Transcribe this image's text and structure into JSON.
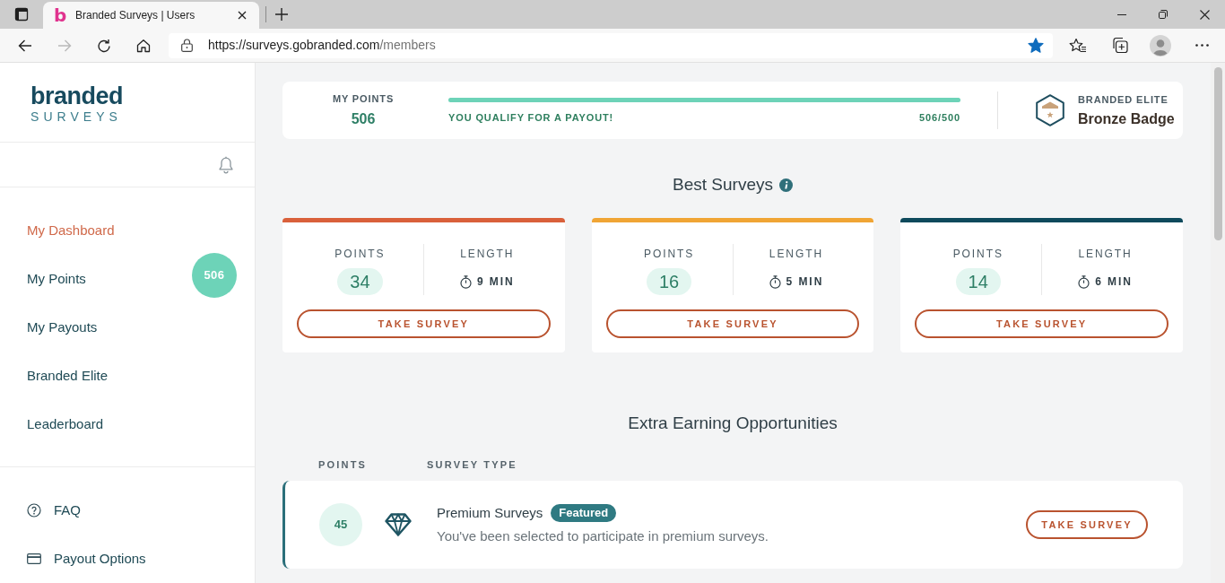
{
  "browser": {
    "favicon": "b",
    "tab_title": "Branded Surveys | Users",
    "url_origin": "https://surveys.gobranded.com",
    "url_path": "/members",
    "forward_disabled": true,
    "bookmarked": true
  },
  "sidebar": {
    "logo": {
      "word": "branded",
      "tagline": "SURVEYS"
    },
    "nav": [
      {
        "label": "My Dashboard",
        "selected": true
      },
      {
        "label": "My Points",
        "selected": false,
        "badge": "506"
      },
      {
        "label": "My Payouts",
        "selected": false
      },
      {
        "label": "Branded Elite",
        "selected": false
      },
      {
        "label": "Leaderboard",
        "selected": false
      }
    ],
    "footer_links": [
      {
        "kind": "help",
        "label": "FAQ"
      },
      {
        "kind": "card",
        "label": "Payout Options"
      }
    ]
  },
  "points_summary": {
    "label": "MY POINTS",
    "value": "506",
    "progress": {
      "level": 1,
      "message": "YOU QUALIFY FOR A PAYOUT!",
      "reading": "506/500"
    },
    "elite": {
      "label": "BRANDED ELITE",
      "badge": "Bronze Badge"
    }
  },
  "best_surveys": {
    "title": "Best Surveys",
    "cards": [
      {
        "color": "#d9603b",
        "points_label": "POINTS",
        "points": "34",
        "length_label": "LENGTH",
        "length": "9 MIN",
        "button": "TAKE SURVEY"
      },
      {
        "color": "#f0a535",
        "points_label": "POINTS",
        "points": "16",
        "length_label": "LENGTH",
        "length": "5 MIN",
        "button": "TAKE SURVEY"
      },
      {
        "color": "#0e4a5c",
        "points_label": "POINTS",
        "points": "14",
        "length_label": "LENGTH",
        "length": "6 MIN",
        "button": "TAKE SURVEY"
      }
    ]
  },
  "extra_earning": {
    "title": "Extra Earning Opportunities",
    "columns": [
      "POINTS",
      "SURVEY TYPE"
    ],
    "rows": [
      {
        "points": "45",
        "title": "Premium Surveys",
        "tag": "Featured",
        "description": "You've been selected to participate in premium surveys.",
        "button": "TAKE SURVEY"
      }
    ]
  }
}
